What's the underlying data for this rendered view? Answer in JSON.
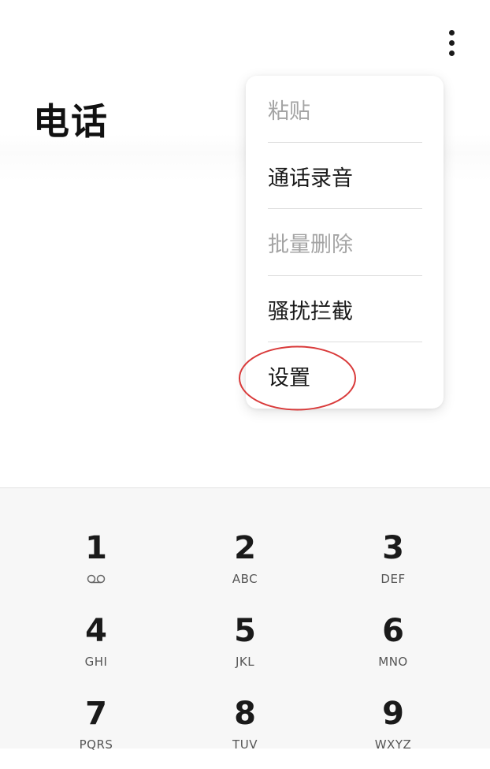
{
  "header": {
    "title": "电话",
    "more_icon": "more-vert-icon"
  },
  "menu": {
    "items": [
      {
        "label": "粘贴",
        "enabled": false
      },
      {
        "label": "通话录音",
        "enabled": true
      },
      {
        "label": "批量删除",
        "enabled": false
      },
      {
        "label": "骚扰拦截",
        "enabled": true
      },
      {
        "label": "设置",
        "enabled": true
      }
    ],
    "highlight_color": "#d93a3a"
  },
  "keypad": {
    "keys": [
      {
        "digit": "1",
        "letters": "",
        "icon": "voicemail-icon"
      },
      {
        "digit": "2",
        "letters": "ABC"
      },
      {
        "digit": "3",
        "letters": "DEF"
      },
      {
        "digit": "4",
        "letters": "GHI"
      },
      {
        "digit": "5",
        "letters": "JKL"
      },
      {
        "digit": "6",
        "letters": "MNO"
      },
      {
        "digit": "7",
        "letters": "PQRS"
      },
      {
        "digit": "8",
        "letters": "TUV"
      },
      {
        "digit": "9",
        "letters": "WXYZ"
      }
    ]
  }
}
